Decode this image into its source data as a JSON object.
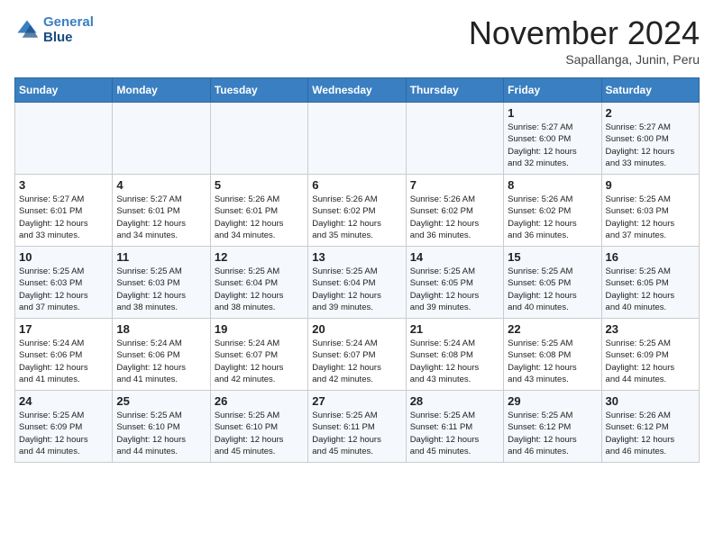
{
  "header": {
    "logo_line1": "General",
    "logo_line2": "Blue",
    "month": "November 2024",
    "location": "Sapallanga, Junin, Peru"
  },
  "weekdays": [
    "Sunday",
    "Monday",
    "Tuesday",
    "Wednesday",
    "Thursday",
    "Friday",
    "Saturday"
  ],
  "weeks": [
    [
      {
        "day": "",
        "info": ""
      },
      {
        "day": "",
        "info": ""
      },
      {
        "day": "",
        "info": ""
      },
      {
        "day": "",
        "info": ""
      },
      {
        "day": "",
        "info": ""
      },
      {
        "day": "1",
        "info": "Sunrise: 5:27 AM\nSunset: 6:00 PM\nDaylight: 12 hours\nand 32 minutes."
      },
      {
        "day": "2",
        "info": "Sunrise: 5:27 AM\nSunset: 6:00 PM\nDaylight: 12 hours\nand 33 minutes."
      }
    ],
    [
      {
        "day": "3",
        "info": "Sunrise: 5:27 AM\nSunset: 6:01 PM\nDaylight: 12 hours\nand 33 minutes."
      },
      {
        "day": "4",
        "info": "Sunrise: 5:27 AM\nSunset: 6:01 PM\nDaylight: 12 hours\nand 34 minutes."
      },
      {
        "day": "5",
        "info": "Sunrise: 5:26 AM\nSunset: 6:01 PM\nDaylight: 12 hours\nand 34 minutes."
      },
      {
        "day": "6",
        "info": "Sunrise: 5:26 AM\nSunset: 6:02 PM\nDaylight: 12 hours\nand 35 minutes."
      },
      {
        "day": "7",
        "info": "Sunrise: 5:26 AM\nSunset: 6:02 PM\nDaylight: 12 hours\nand 36 minutes."
      },
      {
        "day": "8",
        "info": "Sunrise: 5:26 AM\nSunset: 6:02 PM\nDaylight: 12 hours\nand 36 minutes."
      },
      {
        "day": "9",
        "info": "Sunrise: 5:25 AM\nSunset: 6:03 PM\nDaylight: 12 hours\nand 37 minutes."
      }
    ],
    [
      {
        "day": "10",
        "info": "Sunrise: 5:25 AM\nSunset: 6:03 PM\nDaylight: 12 hours\nand 37 minutes."
      },
      {
        "day": "11",
        "info": "Sunrise: 5:25 AM\nSunset: 6:03 PM\nDaylight: 12 hours\nand 38 minutes."
      },
      {
        "day": "12",
        "info": "Sunrise: 5:25 AM\nSunset: 6:04 PM\nDaylight: 12 hours\nand 38 minutes."
      },
      {
        "day": "13",
        "info": "Sunrise: 5:25 AM\nSunset: 6:04 PM\nDaylight: 12 hours\nand 39 minutes."
      },
      {
        "day": "14",
        "info": "Sunrise: 5:25 AM\nSunset: 6:05 PM\nDaylight: 12 hours\nand 39 minutes."
      },
      {
        "day": "15",
        "info": "Sunrise: 5:25 AM\nSunset: 6:05 PM\nDaylight: 12 hours\nand 40 minutes."
      },
      {
        "day": "16",
        "info": "Sunrise: 5:25 AM\nSunset: 6:05 PM\nDaylight: 12 hours\nand 40 minutes."
      }
    ],
    [
      {
        "day": "17",
        "info": "Sunrise: 5:24 AM\nSunset: 6:06 PM\nDaylight: 12 hours\nand 41 minutes."
      },
      {
        "day": "18",
        "info": "Sunrise: 5:24 AM\nSunset: 6:06 PM\nDaylight: 12 hours\nand 41 minutes."
      },
      {
        "day": "19",
        "info": "Sunrise: 5:24 AM\nSunset: 6:07 PM\nDaylight: 12 hours\nand 42 minutes."
      },
      {
        "day": "20",
        "info": "Sunrise: 5:24 AM\nSunset: 6:07 PM\nDaylight: 12 hours\nand 42 minutes."
      },
      {
        "day": "21",
        "info": "Sunrise: 5:24 AM\nSunset: 6:08 PM\nDaylight: 12 hours\nand 43 minutes."
      },
      {
        "day": "22",
        "info": "Sunrise: 5:25 AM\nSunset: 6:08 PM\nDaylight: 12 hours\nand 43 minutes."
      },
      {
        "day": "23",
        "info": "Sunrise: 5:25 AM\nSunset: 6:09 PM\nDaylight: 12 hours\nand 44 minutes."
      }
    ],
    [
      {
        "day": "24",
        "info": "Sunrise: 5:25 AM\nSunset: 6:09 PM\nDaylight: 12 hours\nand 44 minutes."
      },
      {
        "day": "25",
        "info": "Sunrise: 5:25 AM\nSunset: 6:10 PM\nDaylight: 12 hours\nand 44 minutes."
      },
      {
        "day": "26",
        "info": "Sunrise: 5:25 AM\nSunset: 6:10 PM\nDaylight: 12 hours\nand 45 minutes."
      },
      {
        "day": "27",
        "info": "Sunrise: 5:25 AM\nSunset: 6:11 PM\nDaylight: 12 hours\nand 45 minutes."
      },
      {
        "day": "28",
        "info": "Sunrise: 5:25 AM\nSunset: 6:11 PM\nDaylight: 12 hours\nand 45 minutes."
      },
      {
        "day": "29",
        "info": "Sunrise: 5:25 AM\nSunset: 6:12 PM\nDaylight: 12 hours\nand 46 minutes."
      },
      {
        "day": "30",
        "info": "Sunrise: 5:26 AM\nSunset: 6:12 PM\nDaylight: 12 hours\nand 46 minutes."
      }
    ]
  ]
}
